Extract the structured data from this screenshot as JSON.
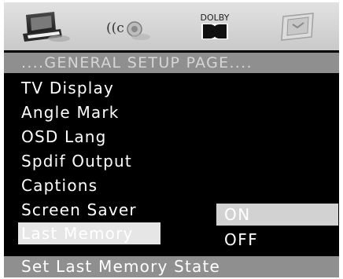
{
  "toolbar": {
    "icons": [
      {
        "name": "general-setup-icon"
      },
      {
        "name": "audio-setup-icon"
      },
      {
        "name": "dolby-icon",
        "label": "DOLBY"
      },
      {
        "name": "preference-icon"
      }
    ]
  },
  "title": "....GENERAL SETUP PAGE....",
  "menu": {
    "items": [
      {
        "label": "TV Display"
      },
      {
        "label": "Angle Mark"
      },
      {
        "label": "OSD Lang"
      },
      {
        "label": "Spdif Output"
      },
      {
        "label": "Captions"
      },
      {
        "label": "Screen Saver"
      },
      {
        "label": "Last Memory",
        "selected": true
      }
    ]
  },
  "submenu": {
    "options": [
      {
        "label": "ON",
        "selected": true
      },
      {
        "label": "OFF"
      }
    ]
  },
  "status": "Set Last Memory State",
  "colors": {
    "background": "#000000",
    "bar": "#8f8f8f",
    "highlight": "#e6e6e6",
    "toolbar": "#d4d4d4"
  }
}
